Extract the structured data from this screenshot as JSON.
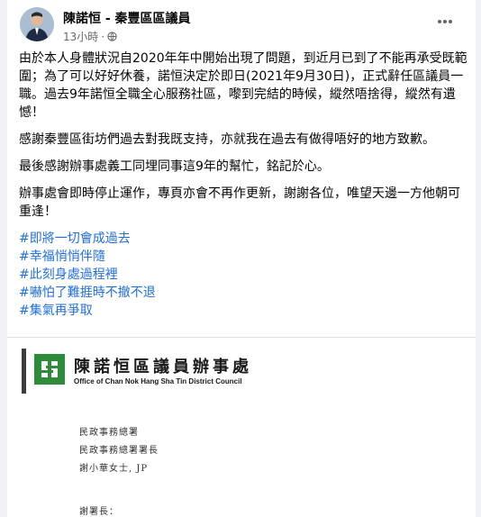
{
  "post": {
    "author": "陳諾恒 - 秦豐區區議員",
    "time": "13小時",
    "separator": "·",
    "paragraphs": [
      "由於本人身體狀況自2020年年中開始出現了問題，到近月已到了不能再承受既範圍；為了可以好好休養，諾恒決定於即日(2021年9月30日)，正式辭任區議員一職。過去9年諾恒全職全心服務社區，嚟到完結的時候，縱然唔捨得，縱然有遺憾！",
      "感謝秦豐區街坊們過去對我既支持，亦就我在過去有做得唔好的地方致歉。",
      "最後感謝辦事處義工同埋同事這9年的幫忙，銘記於心。",
      "辦事處會即時停止運作，專頁亦會不再作更新，謝謝各位，唯望天邊一方他朝可重逢！"
    ],
    "hashtags": [
      "#即將一切會成過去",
      "#幸福悄悄伴隨",
      "#此刻身處過程裡",
      "#嚇怕了難捱時不撤不退",
      "#集氣再爭取"
    ]
  },
  "letter": {
    "office_name_zh": "陳諾恒區議員辦事處",
    "office_name_en": "Office of Chan Nok Hang Sha Tin District Council",
    "recipient_lines": [
      "民政事務總署",
      "民政事務總署署長",
      "謝小華女士, JP"
    ],
    "salutation": "謝署長："
  },
  "colors": {
    "hashtag": "#216fdb",
    "logo_green": "#2e8b3a"
  }
}
